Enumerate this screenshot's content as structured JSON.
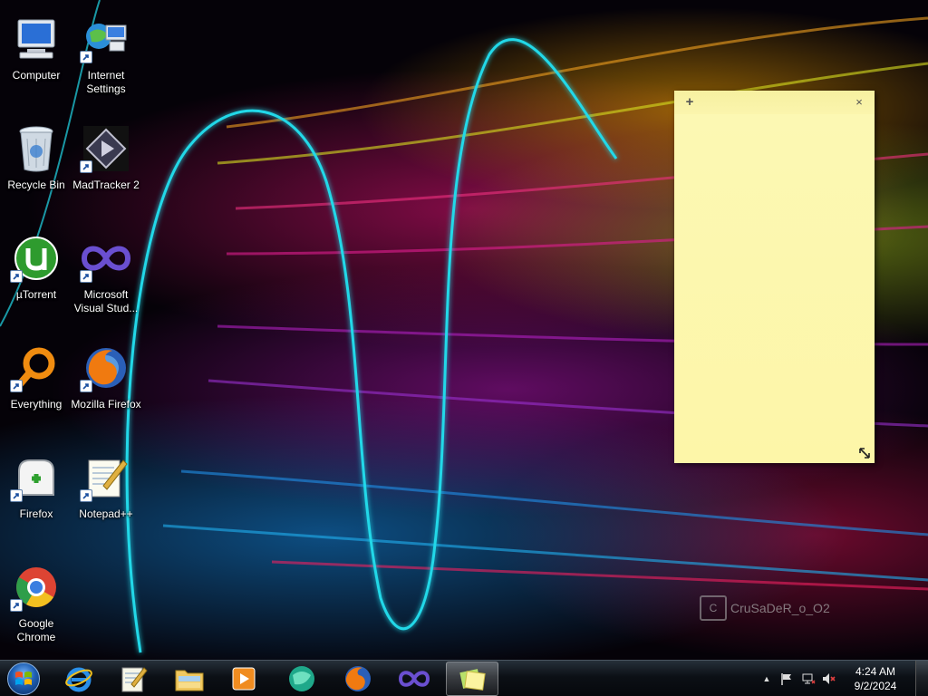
{
  "desktop": {
    "icons": [
      {
        "label": "Computer",
        "icon": "computer-icon",
        "shortcut": false
      },
      {
        "label": "Internet Settings",
        "icon": "internet-settings-icon",
        "shortcut": true
      },
      {
        "label": "Recycle Bin",
        "icon": "recycle-bin-icon",
        "shortcut": false
      },
      {
        "label": "MadTracker 2",
        "icon": "madtracker-icon",
        "shortcut": true
      },
      {
        "label": "µTorrent",
        "icon": "utorrent-icon",
        "shortcut": true
      },
      {
        "label": "Microsoft Visual Stud...",
        "icon": "visual-studio-icon",
        "shortcut": true
      },
      {
        "label": "Everything",
        "icon": "everything-search-icon",
        "shortcut": true
      },
      {
        "label": "Mozilla Firefox",
        "icon": "firefox-icon",
        "shortcut": true
      },
      {
        "label": "Firefox",
        "icon": "firefox-addon-icon",
        "shortcut": true
      },
      {
        "label": "Notepad++",
        "icon": "notepad-plus-plus-icon",
        "shortcut": true
      },
      {
        "label": "Google Chrome",
        "icon": "chrome-icon",
        "shortcut": true
      }
    ]
  },
  "sticky_note": {
    "add_label": "+",
    "close_label": "×",
    "text": ""
  },
  "watermark": {
    "logo_text": "C",
    "text": "CruSaDeR_o_O2"
  },
  "taskbar": {
    "start_icon": "windows-start-orb-icon",
    "pinned": [
      {
        "name": "internet-explorer-icon"
      },
      {
        "name": "notepad-icon"
      },
      {
        "name": "file-explorer-icon"
      },
      {
        "name": "media-player-icon"
      },
      {
        "name": "browser-globe-icon"
      },
      {
        "name": "firefox-icon"
      },
      {
        "name": "visual-studio-icon"
      },
      {
        "name": "sticky-notes-icon"
      }
    ],
    "tray": {
      "show_hidden_label": "▲",
      "time": "4:24 AM",
      "date": "9/2/2024"
    }
  },
  "colors": {
    "sticky_bg": "#fcf8b4",
    "taskbar_bg": "#0c1016",
    "accent_cyan": "#22d8e8"
  }
}
